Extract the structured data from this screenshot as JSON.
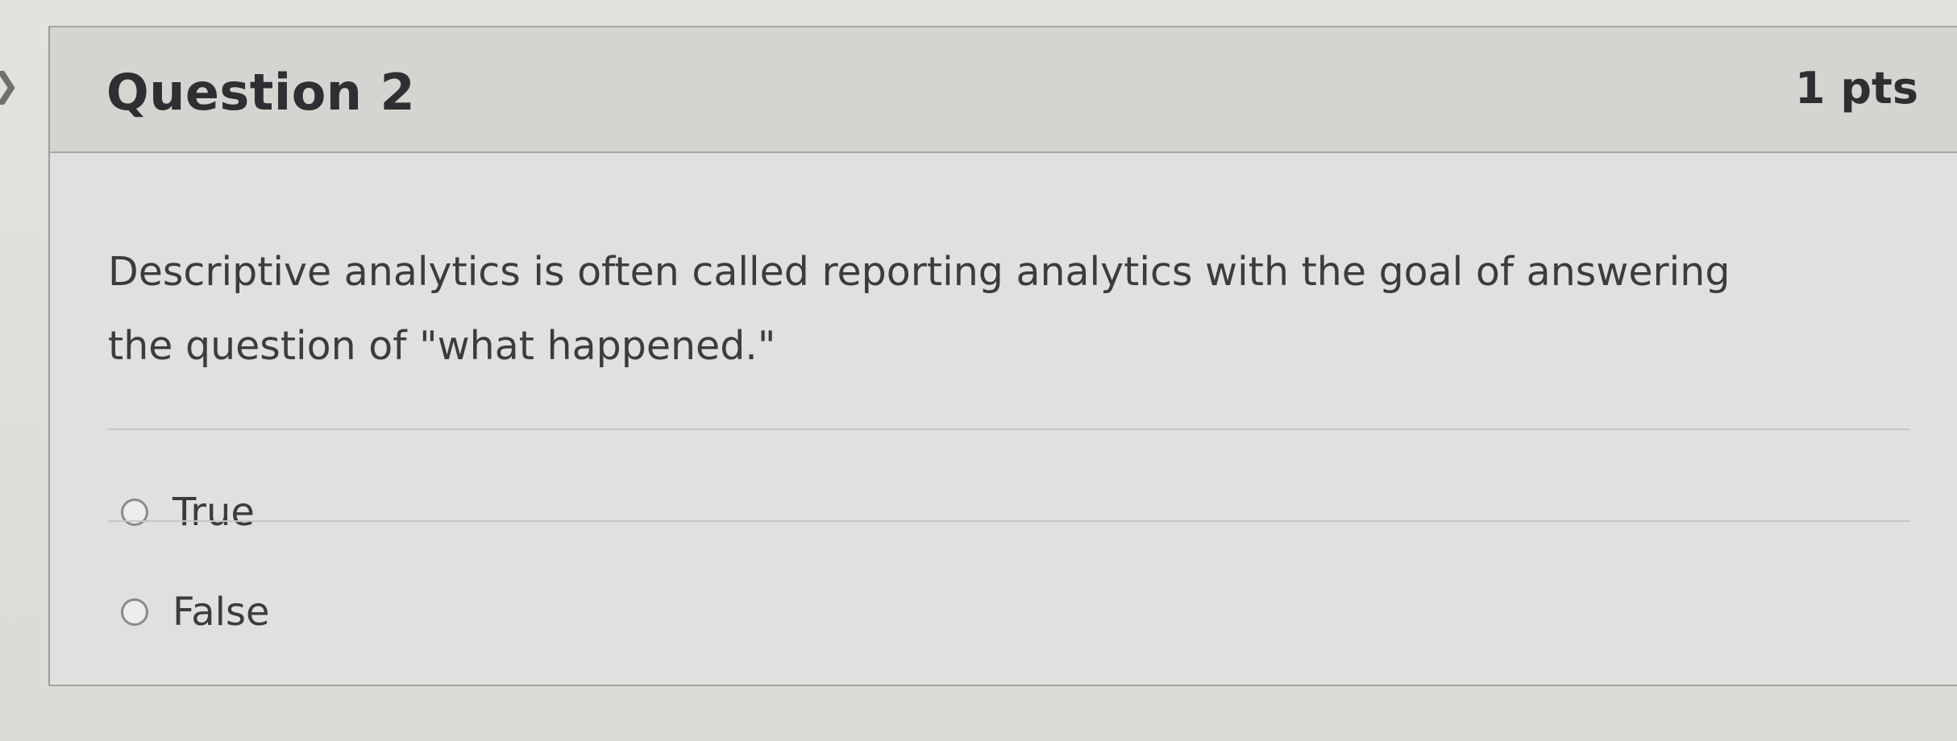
{
  "question": {
    "title": "Question 2",
    "points": "1 pts",
    "text": "Descriptive analytics is often called reporting analytics with the goal of answering the question of \"what happened.\""
  },
  "answers": [
    {
      "label": "True",
      "selected": false
    },
    {
      "label": "False",
      "selected": false
    }
  ],
  "icons": {
    "left_nav": "chevron-right-icon"
  }
}
